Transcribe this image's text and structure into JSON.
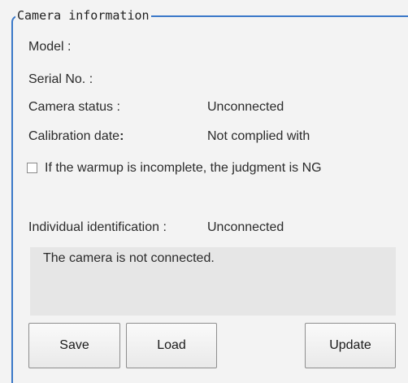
{
  "group": {
    "title": "Camera information"
  },
  "info": {
    "model_label": "Model :",
    "serial_label": "Serial No. :",
    "status_label": "Camera status :",
    "status_value": "Unconnected",
    "calibration_label": "Calibration date",
    "calibration_colon": ":",
    "calibration_value": "Not complied with"
  },
  "warmup": {
    "checked": false,
    "label": "If the warmup is incomplete, the judgment is NG"
  },
  "identification": {
    "label": "Individual identification :",
    "value": "Unconnected"
  },
  "message": {
    "text": "The camera is not connected."
  },
  "buttons": {
    "save": "Save",
    "load": "Load",
    "update": "Update"
  }
}
